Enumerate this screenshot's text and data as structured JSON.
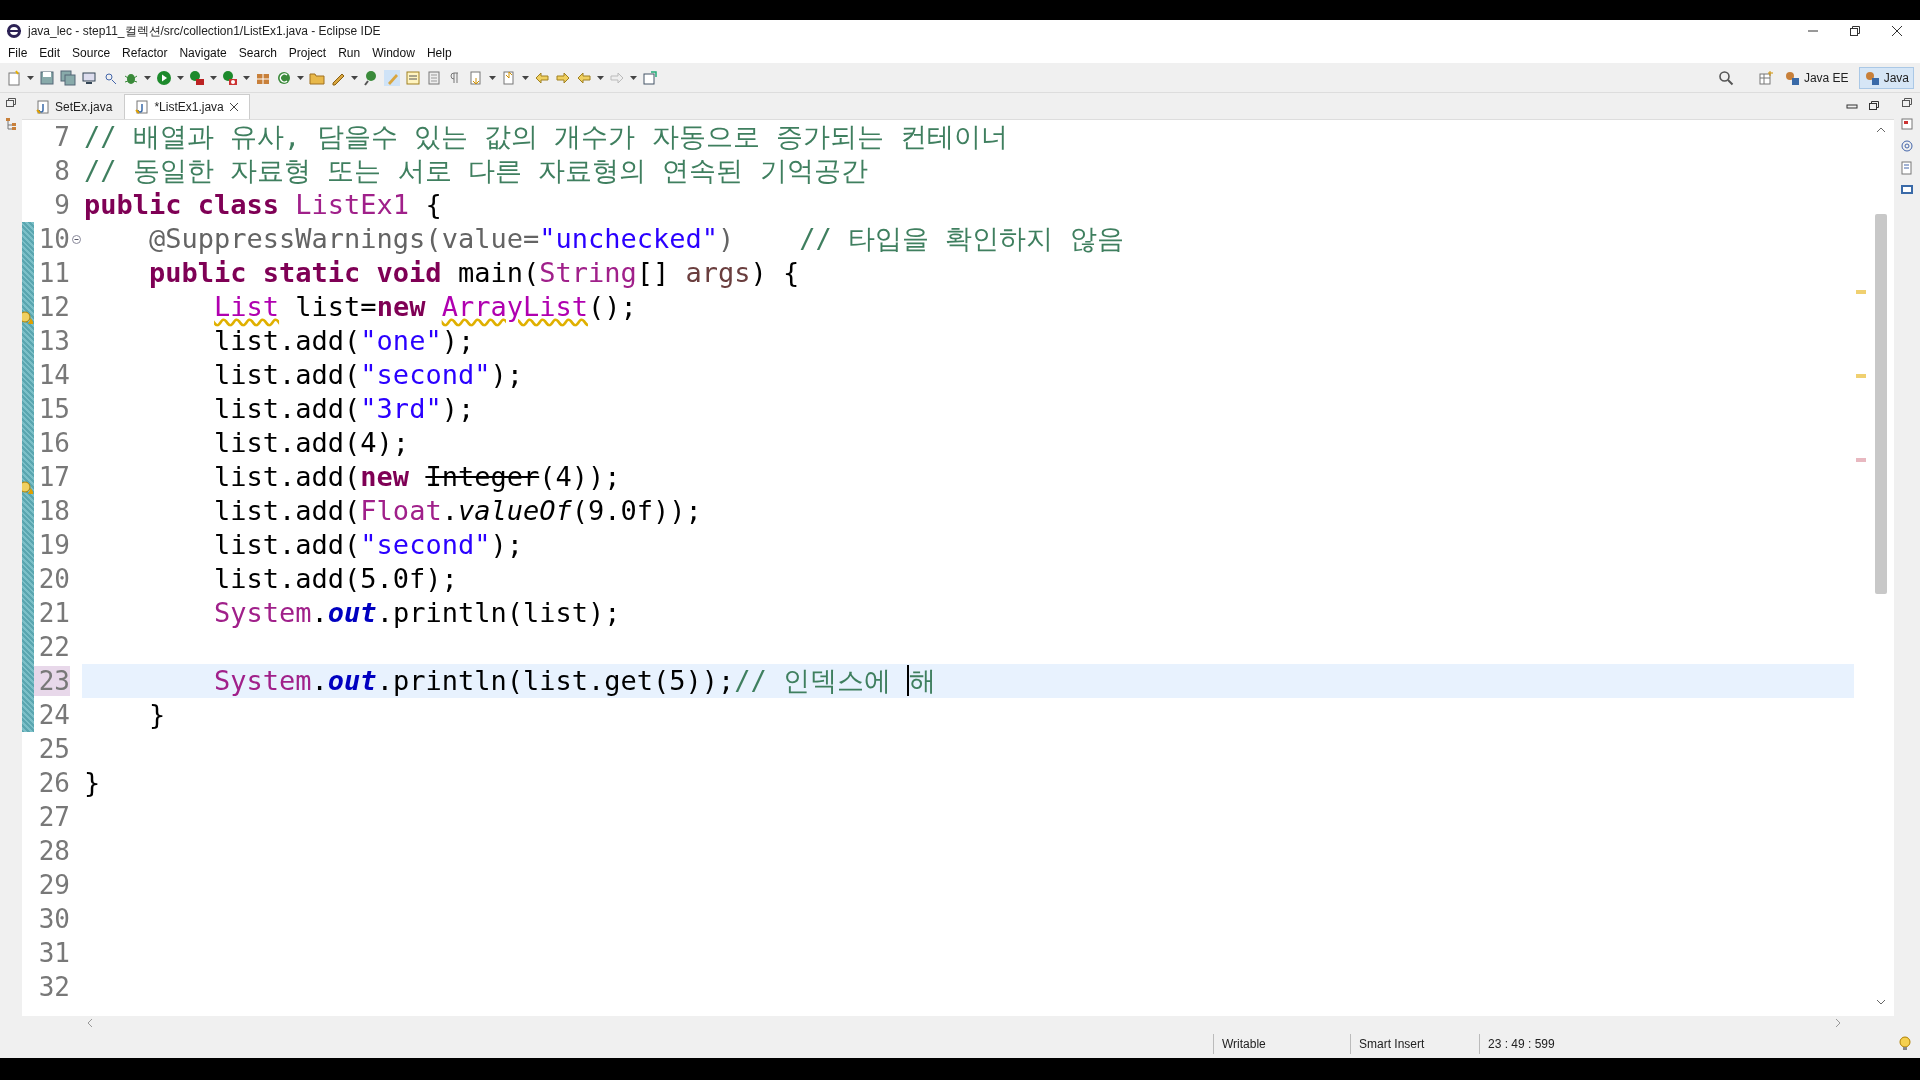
{
  "window": {
    "title": "java_lec - step11_컬렉션/src/collection1/ListEx1.java - Eclipse IDE"
  },
  "menu": [
    "File",
    "Edit",
    "Source",
    "Refactor",
    "Navigate",
    "Search",
    "Project",
    "Run",
    "Window",
    "Help"
  ],
  "perspectives": [
    {
      "label": "Java EE",
      "selected": false
    },
    {
      "label": "Java",
      "selected": true
    }
  ],
  "tabs": [
    {
      "label": "SetEx.java",
      "selected": false
    },
    {
      "label": "*ListEx1.java",
      "selected": true
    }
  ],
  "lines": [
    {
      "number": "7",
      "current": false,
      "changed": false,
      "warning": false,
      "foldable": false,
      "tokens": [
        {
          "kind": "comment",
          "text": "// 배열과 유사, 담을수 있는 값의 개수가 자동으로 증가되는 컨테이너"
        }
      ]
    },
    {
      "number": "8",
      "current": false,
      "changed": false,
      "warning": false,
      "foldable": false,
      "tokens": [
        {
          "kind": "comment",
          "text": "// 동일한 자료형 또는 서로 다른 자료형의 연속된 기억공간"
        }
      ]
    },
    {
      "number": "9",
      "current": false,
      "changed": false,
      "warning": false,
      "foldable": false,
      "tokens": [
        {
          "kind": "keyword",
          "text": "public class "
        },
        {
          "kind": "type",
          "text": "ListEx1"
        },
        {
          "kind": "plain",
          "text": " {"
        }
      ]
    },
    {
      "number": "10",
      "current": false,
      "changed": true,
      "warning": false,
      "foldable": true,
      "tokens": [
        {
          "kind": "annotation",
          "text": "    @SuppressWarnings(value="
        },
        {
          "kind": "string",
          "text": "\"unchecked\""
        },
        {
          "kind": "annotation",
          "text": ")    "
        },
        {
          "kind": "comment",
          "text": "// 타입을 확인하지 않음"
        }
      ]
    },
    {
      "number": "11",
      "current": false,
      "changed": true,
      "warning": false,
      "foldable": false,
      "tokens": [
        {
          "kind": "keyword",
          "text": "    public static void "
        },
        {
          "kind": "plain",
          "text": "main("
        },
        {
          "kind": "type",
          "text": "String"
        },
        {
          "kind": "plain",
          "text": "[] "
        },
        {
          "kind": "param",
          "text": "args"
        },
        {
          "kind": "plain",
          "text": ") {"
        }
      ]
    },
    {
      "number": "12",
      "current": false,
      "changed": true,
      "warning": true,
      "foldable": false,
      "tokens": [
        {
          "kind": "warn-type",
          "text": "        List"
        },
        {
          "kind": "plain",
          "text": " list="
        },
        {
          "kind": "keyword",
          "text": "new "
        },
        {
          "kind": "warn-type",
          "text": "ArrayList"
        },
        {
          "kind": "plain",
          "text": "();"
        }
      ]
    },
    {
      "number": "13",
      "current": false,
      "changed": true,
      "warning": false,
      "foldable": false,
      "tokens": [
        {
          "kind": "plain",
          "text": "        list.add("
        },
        {
          "kind": "string",
          "text": "\"one\""
        },
        {
          "kind": "plain",
          "text": ");"
        }
      ]
    },
    {
      "number": "14",
      "current": false,
      "changed": true,
      "warning": false,
      "foldable": false,
      "tokens": [
        {
          "kind": "plain",
          "text": "        list.add("
        },
        {
          "kind": "string",
          "text": "\"second\""
        },
        {
          "kind": "plain",
          "text": ");"
        }
      ]
    },
    {
      "number": "15",
      "current": false,
      "changed": true,
      "warning": false,
      "foldable": false,
      "tokens": [
        {
          "kind": "plain",
          "text": "        list.add("
        },
        {
          "kind": "string",
          "text": "\"3rd\""
        },
        {
          "kind": "plain",
          "text": ");"
        }
      ]
    },
    {
      "number": "16",
      "current": false,
      "changed": true,
      "warning": false,
      "foldable": false,
      "tokens": [
        {
          "kind": "plain",
          "text": "        list.add(4);"
        }
      ]
    },
    {
      "number": "17",
      "current": false,
      "changed": true,
      "warning": true,
      "foldable": false,
      "tokens": [
        {
          "kind": "plain",
          "text": "        list.add("
        },
        {
          "kind": "keyword",
          "text": "new "
        },
        {
          "kind": "deprecated",
          "text": "Integer"
        },
        {
          "kind": "plain",
          "text": "(4));"
        }
      ]
    },
    {
      "number": "18",
      "current": false,
      "changed": true,
      "warning": false,
      "foldable": false,
      "tokens": [
        {
          "kind": "plain",
          "text": "        list.add("
        },
        {
          "kind": "type",
          "text": "Float"
        },
        {
          "kind": "plain",
          "text": "."
        },
        {
          "kind": "static-method",
          "text": "valueOf"
        },
        {
          "kind": "plain",
          "text": "(9.0f));"
        }
      ]
    },
    {
      "number": "19",
      "current": false,
      "changed": true,
      "warning": false,
      "foldable": false,
      "tokens": [
        {
          "kind": "plain",
          "text": "        list.add("
        },
        {
          "kind": "string",
          "text": "\"second\""
        },
        {
          "kind": "plain",
          "text": ");"
        }
      ]
    },
    {
      "number": "20",
      "current": false,
      "changed": true,
      "warning": false,
      "foldable": false,
      "tokens": [
        {
          "kind": "plain",
          "text": "        list.add(5.0f);"
        }
      ]
    },
    {
      "number": "21",
      "current": false,
      "changed": true,
      "warning": false,
      "foldable": false,
      "tokens": [
        {
          "kind": "type",
          "text": "        System"
        },
        {
          "kind": "plain",
          "text": "."
        },
        {
          "kind": "static-field",
          "text": "out"
        },
        {
          "kind": "plain",
          "text": ".println(list);"
        }
      ]
    },
    {
      "number": "22",
      "current": false,
      "changed": true,
      "warning": false,
      "foldable": false
    },
    {
      "number": "23",
      "current": true,
      "changed": true,
      "warning": false,
      "foldable": false,
      "tokens": [
        {
          "kind": "type",
          "text": "        System"
        },
        {
          "kind": "plain",
          "text": "."
        },
        {
          "kind": "static-field",
          "text": "out"
        },
        {
          "kind": "plain",
          "text": ".println(list.get(5));"
        },
        {
          "kind": "comment",
          "text": "// 인덱스에 "
        },
        {
          "kind": "composing",
          "text": "해"
        }
      ]
    },
    {
      "number": "24",
      "current": false,
      "changed": true,
      "warning": false,
      "foldable": false,
      "tokens": [
        {
          "kind": "plain",
          "text": "    }"
        }
      ]
    },
    {
      "number": "25",
      "current": false,
      "changed": false,
      "warning": false,
      "foldable": false
    },
    {
      "number": "26",
      "current": false,
      "changed": false,
      "warning": false,
      "foldable": false,
      "tokens": [
        {
          "kind": "plain",
          "text": "}"
        }
      ]
    },
    {
      "number": "27",
      "current": false,
      "changed": false,
      "warning": false,
      "foldable": false
    },
    {
      "number": "28",
      "current": false,
      "changed": false,
      "warning": false,
      "foldable": false
    },
    {
      "number": "29",
      "current": false,
      "changed": false,
      "warning": false,
      "foldable": false
    },
    {
      "number": "30",
      "current": false,
      "changed": false,
      "warning": false,
      "foldable": false
    },
    {
      "number": "31",
      "current": false,
      "changed": false,
      "warning": false,
      "foldable": false
    },
    {
      "number": "32",
      "current": false,
      "changed": false,
      "warning": false,
      "foldable": false
    }
  ],
  "status_bar": {
    "mode": "Writable",
    "insert": "Smart Insert",
    "position": "23 : 49 : 599"
  }
}
